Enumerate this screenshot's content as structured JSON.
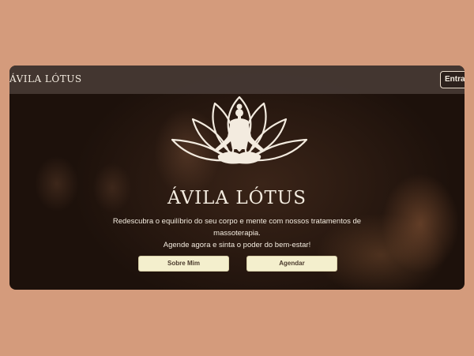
{
  "nav": {
    "brand": "ÁVILA LÓTUS",
    "login_label": "Entrar"
  },
  "hero": {
    "logo_icon": "lotus-meditation-icon",
    "title": "ÁVILA LÓTUS",
    "description_line1": "Redescubra o equilíbrio do seu corpo e mente com nossos tratamentos de massoterapia.",
    "description_line2": "Agende agora e sinta o poder do bem-estar!",
    "buttons": {
      "about": "Sobre Mim",
      "schedule": "Agendar"
    }
  },
  "colors": {
    "page_background": "#d49b7c",
    "button_background": "#f4efcd",
    "text_light": "#f3ebdf"
  }
}
